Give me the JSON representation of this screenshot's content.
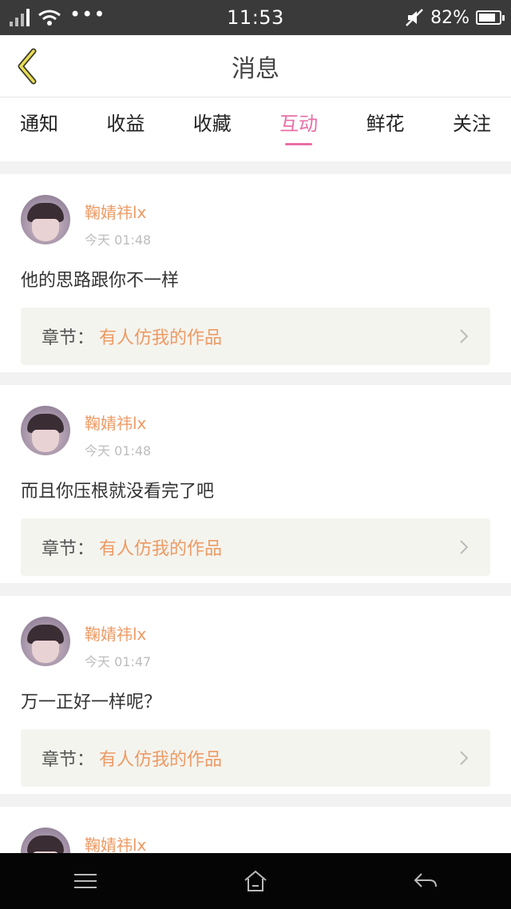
{
  "status_bar": {
    "time": "11:53",
    "battery": "82%",
    "battery_level": 0.82,
    "icons": [
      "signal-icon",
      "wifi-icon",
      "more-dots-icon",
      "mute-icon",
      "battery-icon"
    ]
  },
  "header": {
    "title": "消息",
    "back_icon": "back-chevron-icon"
  },
  "tabs": [
    {
      "label": "通知",
      "active": false
    },
    {
      "label": "收益",
      "active": false
    },
    {
      "label": "收藏",
      "active": false
    },
    {
      "label": "互动",
      "active": true
    },
    {
      "label": "鲜花",
      "active": false
    },
    {
      "label": "关注",
      "active": false
    }
  ],
  "colors": {
    "accent_tab": "#e86fa7",
    "username": "#ee9a63",
    "chapter_title": "#ee9a63"
  },
  "messages": [
    {
      "username": "鞠婧祎lx",
      "time": "今天 01:48",
      "text": "他的思路跟你不一样",
      "chapter_label": "章节：",
      "chapter_title": "有人仿我的作品"
    },
    {
      "username": "鞠婧祎lx",
      "time": "今天 01:48",
      "text": "而且你压根就没看完了吧",
      "chapter_label": "章节：",
      "chapter_title": "有人仿我的作品"
    },
    {
      "username": "鞠婧祎lx",
      "time": "今天 01:47",
      "text": "万一正好一样呢？",
      "chapter_label": "章节：",
      "chapter_title": "有人仿我的作品"
    },
    {
      "username": "鞠婧祎lx"
    }
  ],
  "nav_bar": {
    "icons": [
      "menu-icon",
      "home-icon",
      "back-arrow-icon"
    ]
  }
}
